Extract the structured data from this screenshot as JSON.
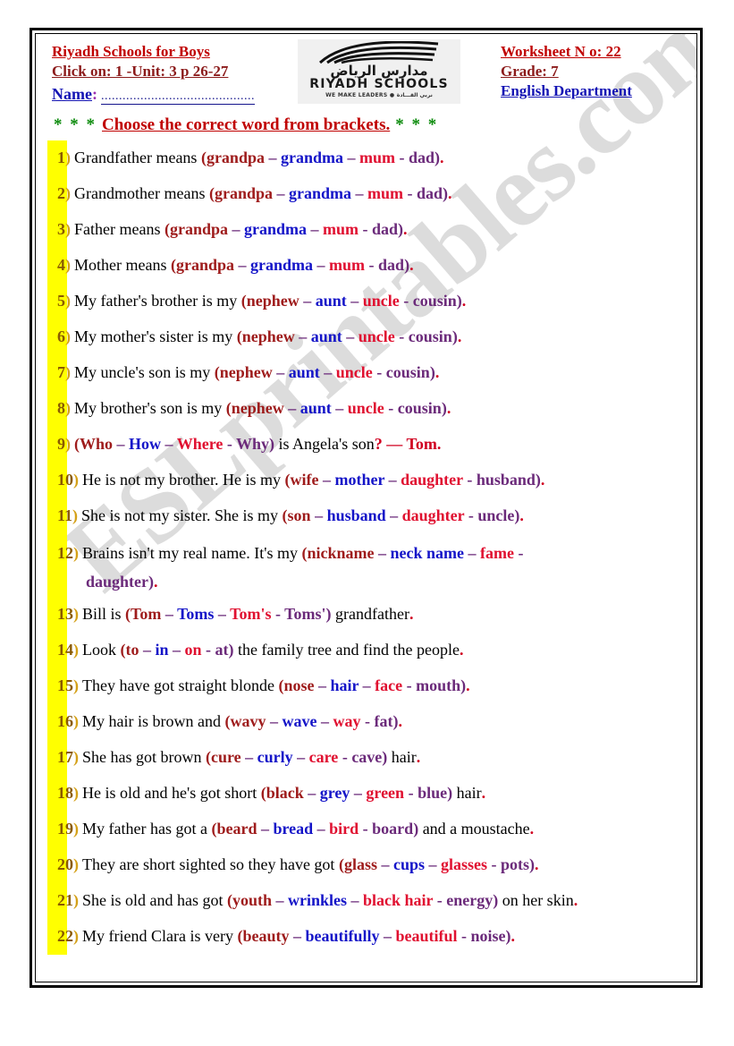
{
  "header": {
    "school_name": "Riyadh Schools for Boys",
    "unit_line": "Click on: 1 -Unit: 3  p 26-27",
    "name_label": "Name",
    "name_colon": ":",
    "name_dots": "...........................................",
    "worksheet_no": "Worksheet N o: 22",
    "grade": "Grade: 7",
    "department": "English Department",
    "logo": {
      "arabic_title": "مدارس الرياض",
      "english_title": "RIYADH SCHOOLS",
      "tagline_en": "WE MAKE LEADERS",
      "tagline_ar": "نربي القـــادة",
      "separator": "●"
    }
  },
  "instruction": {
    "stars_left": "* * *",
    "text": "Choose the correct word from brackets.",
    "stars_right": "* * *"
  },
  "colors": {
    "highlight": "#ffff00",
    "heading_red": "#c00000",
    "heading_blue": "#1414b4",
    "stars_green": "#0a8a0a",
    "option1_darkred": "#9e1b1b",
    "option2_blue": "#1414c8",
    "option3_red": "#e01030",
    "option4_purple": "#6b2a7a",
    "question_number": "#8a5a00",
    "body_text": "#000000"
  },
  "watermark": {
    "text": "ESLprintables.com"
  },
  "questions": [
    {
      "num": "1",
      "pre": "Grandfather means ",
      "options": [
        "grandpa",
        "grandma",
        "mum",
        "dad"
      ],
      "post": "",
      "end": "."
    },
    {
      "num": "2",
      "pre": "Grandmother means ",
      "options": [
        "grandpa",
        "grandma",
        "mum",
        "dad"
      ],
      "post": "",
      "end": "."
    },
    {
      "num": "3",
      "pre": "Father means ",
      "options": [
        "grandpa",
        "grandma",
        "mum",
        "dad"
      ],
      "post": "",
      "end": "."
    },
    {
      "num": "4",
      "pre": "Mother means ",
      "options": [
        "grandpa",
        "grandma",
        "mum",
        "dad"
      ],
      "post": "",
      "end": "."
    },
    {
      "num": "5",
      "pre": "My father's brother is my ",
      "options": [
        "nephew",
        "aunt",
        "uncle",
        "cousin"
      ],
      "post": "",
      "end": "."
    },
    {
      "num": "6",
      "pre": "My mother's sister is my ",
      "options": [
        "nephew",
        "aunt",
        "uncle",
        "cousin"
      ],
      "post": "",
      "end": "."
    },
    {
      "num": "7",
      "pre": "My uncle's son is my ",
      "options": [
        "nephew",
        "aunt",
        "uncle",
        "cousin"
      ],
      "post": "",
      "end": "."
    },
    {
      "num": "8",
      "pre": "My brother's son is my ",
      "options": [
        "nephew",
        "aunt",
        "uncle",
        "cousin"
      ],
      "post": "",
      "end": "."
    },
    {
      "num": "9",
      "pre": "",
      "options": [
        "Who",
        "How",
        "Where",
        "Why"
      ],
      "post": " is Angela's son",
      "end": "?  — Tom."
    },
    {
      "num": "10",
      "pre": "He is not my brother. He is my ",
      "options": [
        "wife",
        "mother",
        "daughter",
        "husband"
      ],
      "post": "",
      "end": "."
    },
    {
      "num": "11",
      "pre": "She is not my sister. She is my ",
      "options": [
        "son",
        "husband",
        "daughter",
        "uncle"
      ],
      "post": "",
      "end": "."
    },
    {
      "num": "12",
      "pre": "Brains isn't my real name. It's my ",
      "options": [
        "nickname",
        "neck name",
        "fame",
        "daughter"
      ],
      "post": "",
      "end": ".",
      "wrap": true
    },
    {
      "num": "13",
      "pre": "Bill is ",
      "options": [
        "Tom",
        "Toms",
        "Tom's",
        "Toms'"
      ],
      "post": " grandfather",
      "end": "."
    },
    {
      "num": "14",
      "pre": "Look ",
      "options": [
        "to",
        "in",
        "on",
        "at"
      ],
      "post": " the family tree and find the people",
      "end": "."
    },
    {
      "num": "15",
      "pre": "They have got straight blonde ",
      "options": [
        "nose",
        "hair",
        "face",
        "mouth"
      ],
      "post": "",
      "end": "."
    },
    {
      "num": "16",
      "pre": "My hair is brown and ",
      "options": [
        "wavy",
        "wave",
        "way",
        "fat"
      ],
      "post": "",
      "end": "."
    },
    {
      "num": "17",
      "pre": "She has got brown ",
      "options": [
        "cure",
        "curly",
        "care",
        "cave"
      ],
      "post": " hair",
      "end": "."
    },
    {
      "num": "18",
      "pre": "He is old and he's got short ",
      "options": [
        "black",
        "grey",
        "green",
        "blue"
      ],
      "post": " hair",
      "end": "."
    },
    {
      "num": "19",
      "pre": "My father has got a ",
      "options": [
        "beard",
        "bread",
        "bird",
        "board"
      ],
      "post": " and a  moustache",
      "end": "."
    },
    {
      "num": "20",
      "pre": "They are short sighted so they have got ",
      "options": [
        "glass",
        "cups",
        "glasses",
        "pots"
      ],
      "post": "",
      "end": "."
    },
    {
      "num": "21",
      "pre": "She is old and has got ",
      "options": [
        "youth",
        "wrinkles",
        "black hair",
        "energy"
      ],
      "post": " on her skin",
      "end": "."
    },
    {
      "num": "22",
      "pre": "My friend Clara is very ",
      "options": [
        "beauty",
        "beautifully",
        "beautiful",
        "noise"
      ],
      "post": "",
      "end": "."
    }
  ]
}
